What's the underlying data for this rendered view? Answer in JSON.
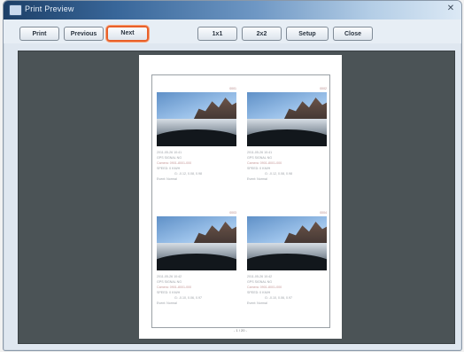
{
  "window": {
    "title": "Print Preview"
  },
  "toolbar": {
    "print": "Print",
    "previous": "Previous",
    "next": "Next",
    "one_by_one": "1x1",
    "two_by_two": "2x2",
    "setup": "Setup",
    "close": "Close"
  },
  "page": {
    "page_number": "- 1 / 20 -",
    "cards": [
      {
        "tag": "0001",
        "lines": [
          "2011-05-26 10:41",
          "GPS SIGNAL NG",
          "Camera: 0901-8001-000",
          "SPEED: 0 KM/H",
          "G: -0.12, 0.08, 0.98",
          "Event: Normal"
        ]
      },
      {
        "tag": "0002",
        "lines": [
          "2011-05-26 10:41",
          "GPS SIGNAL NG",
          "Camera: 0901-8001-000",
          "SPEED: 0 KM/H",
          "G: -0.12, 0.08, 0.98",
          "Event: Normal"
        ]
      },
      {
        "tag": "0003",
        "lines": [
          "2011-05-26 10:42",
          "GPS SIGNAL NG",
          "Camera: 0901-8001-000",
          "SPEED: 0 KM/H",
          "G: -0.10, 0.06, 0.97",
          "Event: Normal"
        ]
      },
      {
        "tag": "0004",
        "lines": [
          "2011-05-26 10:42",
          "GPS SIGNAL NG",
          "Camera: 0901-8001-000",
          "SPEED: 0 KM/H",
          "G: -0.10, 0.06, 0.97",
          "Event: Normal"
        ]
      }
    ]
  }
}
